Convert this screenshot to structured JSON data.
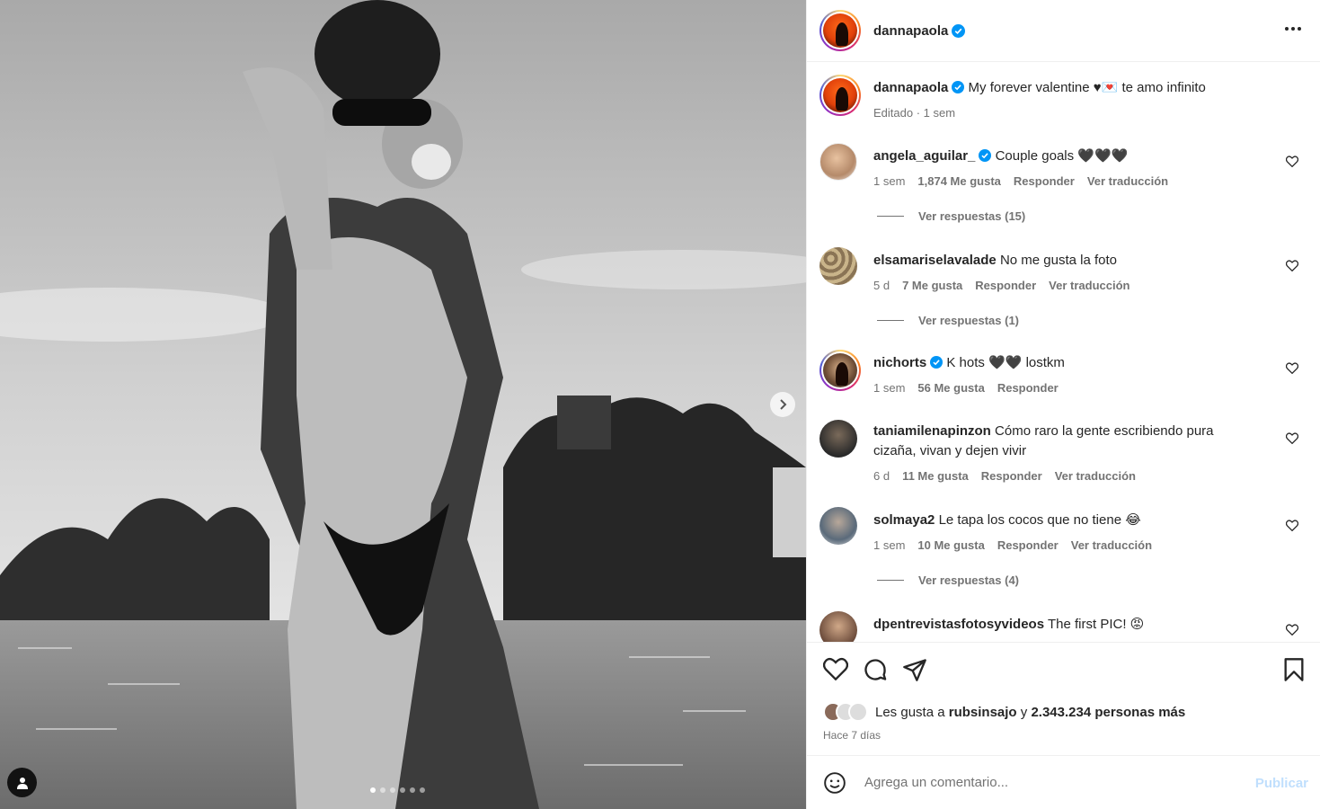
{
  "post": {
    "username": "dannapaola",
    "caption": "My forever valentine ♥💌 te amo infinito",
    "caption_meta": "Editado · 1 sem",
    "verified_color": "#0095f6"
  },
  "media": {
    "slide_count": 6,
    "active_slide": 1
  },
  "comments": [
    {
      "user": "angela_aguilar_",
      "verified": true,
      "text": "Couple goals 🖤🖤🖤",
      "time": "1 sem",
      "likes": "1,874 Me gusta",
      "reply": "Responder",
      "translate": "Ver traducción",
      "replies": "Ver respuestas (15)"
    },
    {
      "user": "elsamariselavalade",
      "verified": false,
      "text": "No me gusta la foto",
      "time": "5 d",
      "likes": "7 Me gusta",
      "reply": "Responder",
      "translate": "Ver traducción",
      "replies": "Ver respuestas (1)"
    },
    {
      "user": "nichorts",
      "verified": true,
      "text": "K hots 🖤🖤 lostkm",
      "time": "1 sem",
      "likes": "56 Me gusta",
      "reply": "Responder"
    },
    {
      "user": "taniamilenapinzon",
      "verified": false,
      "text": "Cómo raro la gente escribiendo pura cizaña, vivan y dejen vivir",
      "time": "6 d",
      "likes": "11 Me gusta",
      "reply": "Responder",
      "translate": "Ver traducción"
    },
    {
      "user": "solmaya2",
      "verified": false,
      "text": "Le tapa los cocos que no tiene 😂",
      "time": "1 sem",
      "likes": "10 Me gusta",
      "reply": "Responder",
      "translate": "Ver traducción",
      "replies": "Ver respuestas (4)"
    },
    {
      "user": "dpentrevistasfotosyvideos",
      "verified": false,
      "text": "The first PIC! 😡"
    }
  ],
  "likes": {
    "prefix": "Les gusta a",
    "user": "rubsinsajo",
    "mid": "y",
    "count": "2.343.234 personas más"
  },
  "time_ago": "Hace 7 días",
  "add_comment": {
    "placeholder": "Agrega un comentario...",
    "publish": "Publicar"
  }
}
